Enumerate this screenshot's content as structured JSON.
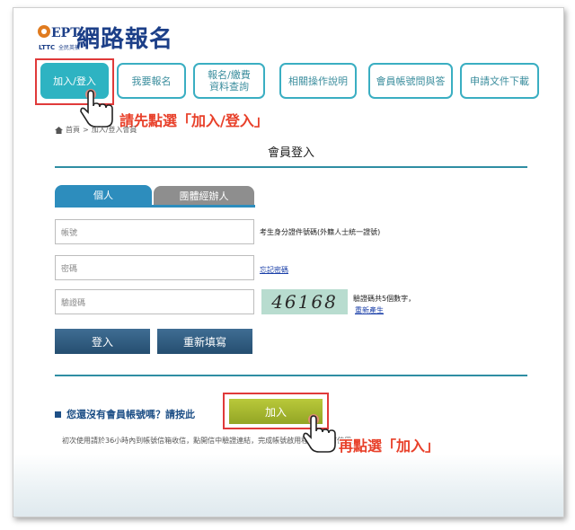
{
  "header": {
    "logo_brand": "GEPT",
    "logo_sub": "LTTC 全民英檢",
    "title": "網路報名"
  },
  "nav": {
    "items": [
      {
        "label": "加入/登入"
      },
      {
        "label": "我要報名"
      },
      {
        "label": "報名/繳費\n資料查詢"
      },
      {
        "label": "相關操作說明"
      },
      {
        "label": "會員帳號問與答"
      },
      {
        "label": "申請文件下載"
      }
    ]
  },
  "callouts": {
    "first": "請先點選「加入/登入」",
    "second": "再點選「加入」"
  },
  "breadcrumb": {
    "items": [
      "首頁",
      ">",
      "加入/登入會員"
    ]
  },
  "login": {
    "title": "會員登入",
    "tabs": [
      "個人",
      "團體經辦人"
    ],
    "account_placeholder": "帳號",
    "account_note": "考生身分證件號碼(外籍人士統一證號)",
    "password_placeholder": "密碼",
    "forgot_password": "忘記密碼",
    "captcha_placeholder": "驗證碼",
    "captcha_value": "46168",
    "captcha_note": "驗證碼共5個數字，",
    "captcha_refresh": "重新產生",
    "login_button": "登入",
    "reset_button": "重新填寫"
  },
  "signup": {
    "question": "您還沒有會員帳號嗎？請按此",
    "join_button": "加入",
    "note": "初次使用請於36小時內到帳號信箱收信，點開信中驗證連結，完成帳號啟用程序後才可使用。"
  },
  "colors": {
    "accent": "#2eb3c2",
    "nav_border": "#3aaec2",
    "callout": "#e8402a",
    "highlight": "#e03a3a",
    "rule": "#2f8ea3",
    "tab_active": "#2d8dbd",
    "tab_inactive": "#8e8e8e",
    "button_dark": "#2b587d",
    "button_join": "#a4b52f"
  }
}
